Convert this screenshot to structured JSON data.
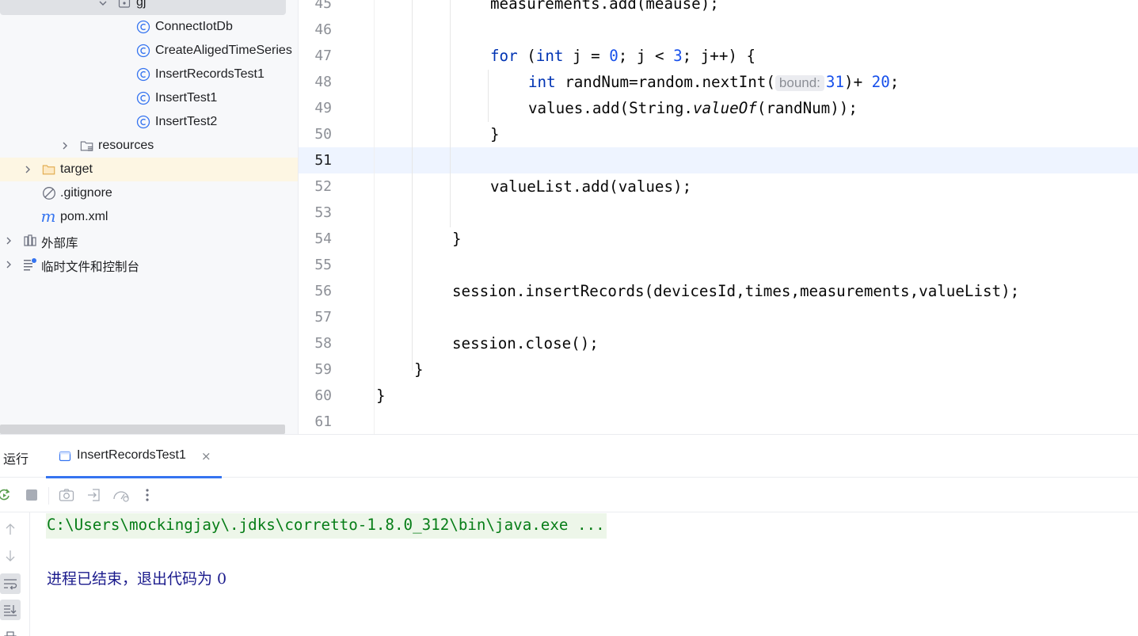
{
  "tree": {
    "items": [
      {
        "label": "gj",
        "icon": "package-icon"
      },
      {
        "label": "ConnectIotDb",
        "icon": "class-icon"
      },
      {
        "label": "CreateAligedTimeSeries",
        "icon": "class-icon"
      },
      {
        "label": "InsertRecordsTest1",
        "icon": "class-icon"
      },
      {
        "label": "InsertTest1",
        "icon": "class-icon"
      },
      {
        "label": "InsertTest2",
        "icon": "class-icon"
      },
      {
        "label": "resources",
        "icon": "resources-folder-icon"
      },
      {
        "label": "target",
        "icon": "folder-icon"
      },
      {
        "label": ".gitignore",
        "icon": "ignore-file-icon"
      },
      {
        "label": "pom.xml",
        "icon": "maven-icon"
      },
      {
        "label": "外部库",
        "icon": "library-icon"
      },
      {
        "label": "临时文件和控制台",
        "icon": "scratches-icon"
      }
    ]
  },
  "editor": {
    "line_numbers": [
      "45",
      "46",
      "47",
      "48",
      "49",
      "50",
      "51",
      "52",
      "53",
      "54",
      "55",
      "56",
      "57",
      "58",
      "59",
      "60",
      "61"
    ],
    "current_line": "51"
  },
  "run": {
    "title": "运行",
    "tab_label": "InsertRecordsTest1",
    "tab_close": "×",
    "console_command": "C:\\Users\\mockingjay\\.jdks\\corretto-1.8.0_312\\bin\\java.exe ...",
    "console_exit": "进程已结束，退出代码为 0"
  },
  "colors": {
    "keyword": "#0033b3",
    "number": "#1750eb",
    "accent": "#3574f0",
    "class_icon": "#3574f0",
    "current_line_bg": "#eef4ff",
    "console_cmd_bg": "#edf6e9",
    "console_cmd_text": "#067d17"
  }
}
